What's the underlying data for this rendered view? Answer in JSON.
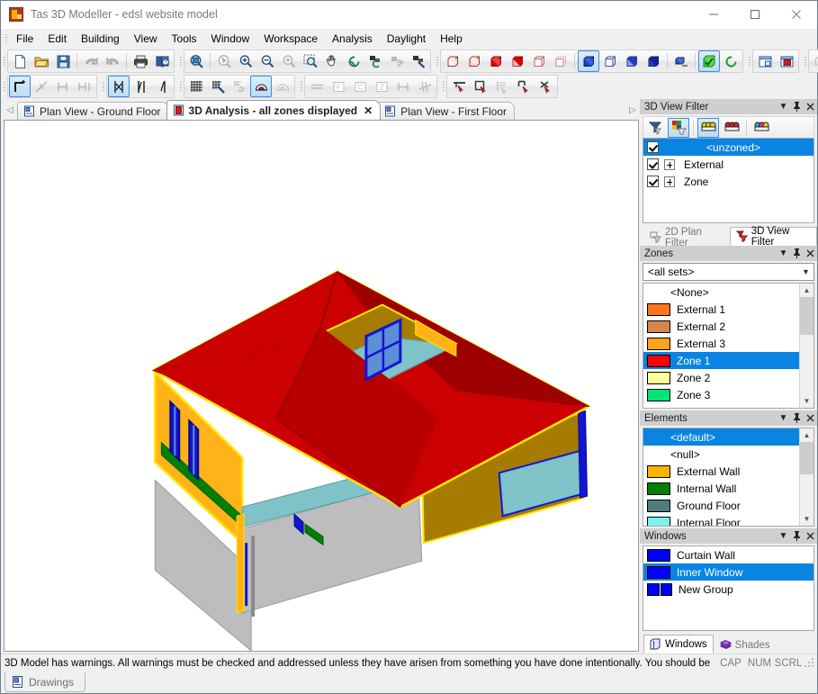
{
  "window": {
    "title": "Tas 3D Modeller - edsl website model",
    "app_icon": "tas-app-icon",
    "controls": {
      "minimize": "minimize-icon",
      "maximize": "maximize-icon",
      "close": "close-icon"
    }
  },
  "menubar": {
    "items": [
      {
        "label": "File"
      },
      {
        "label": "Edit"
      },
      {
        "label": "Building"
      },
      {
        "label": "View"
      },
      {
        "label": "Tools"
      },
      {
        "label": "Window"
      },
      {
        "label": "Workspace"
      },
      {
        "label": "Analysis"
      },
      {
        "label": "Daylight"
      },
      {
        "label": "Help"
      }
    ]
  },
  "toolbars": {
    "row1": [
      {
        "group": "file",
        "buttons": [
          {
            "name": "new-file-icon",
            "selected": false,
            "enabled": true
          },
          {
            "name": "open-folder-icon",
            "selected": false,
            "enabled": true
          },
          {
            "name": "save-disk-icon",
            "selected": false,
            "enabled": true
          },
          {
            "sep": true
          },
          {
            "name": "undo-icon",
            "selected": false,
            "enabled": false
          },
          {
            "name": "redo-icon",
            "selected": false,
            "enabled": false
          },
          {
            "sep": true
          },
          {
            "name": "print-icon",
            "selected": false,
            "enabled": true
          },
          {
            "name": "help-book-icon",
            "selected": false,
            "enabled": true
          }
        ]
      },
      {
        "group": "zoom",
        "buttons": [
          {
            "name": "zoom-extents-icon",
            "selected": false,
            "enabled": true
          },
          {
            "sep": true
          },
          {
            "name": "zoom-select-icon",
            "selected": false,
            "enabled": false
          },
          {
            "name": "zoom-in-icon",
            "selected": false,
            "enabled": true
          },
          {
            "name": "zoom-out-icon",
            "selected": false,
            "enabled": true
          },
          {
            "name": "zoom-reset-icon",
            "selected": false,
            "enabled": false
          },
          {
            "name": "zoom-window-icon",
            "selected": false,
            "enabled": true
          },
          {
            "name": "pan-hand-icon",
            "selected": false,
            "enabled": true
          },
          {
            "name": "orbit-rotate-icon",
            "selected": false,
            "enabled": true
          },
          {
            "name": "rotate-view-icon",
            "selected": false,
            "enabled": true
          },
          {
            "name": "view-arrow-icon",
            "selected": false,
            "enabled": false
          },
          {
            "name": "view-pick-icon",
            "selected": false,
            "enabled": true
          }
        ]
      },
      {
        "group": "zone-display",
        "buttons": [
          {
            "name": "zone-outline-icon",
            "selected": false,
            "enabled": true
          },
          {
            "name": "zone-shaded-icon",
            "selected": false,
            "enabled": true
          },
          {
            "name": "zone-solid-red-icon",
            "selected": false,
            "enabled": true
          },
          {
            "name": "zone-solid-shaded-icon",
            "selected": false,
            "enabled": true
          },
          {
            "name": "zone-wire-icon",
            "selected": false,
            "enabled": true
          },
          {
            "name": "zone-hidden-icon",
            "selected": false,
            "enabled": true
          },
          {
            "sep": true
          },
          {
            "name": "view-solid-blue-icon",
            "selected": true,
            "enabled": true
          },
          {
            "name": "view-wireframe-icon",
            "selected": false,
            "enabled": true
          },
          {
            "name": "view-shaded-blue-icon",
            "selected": false,
            "enabled": true
          },
          {
            "name": "view-render-blue-icon",
            "selected": false,
            "enabled": true
          },
          {
            "sep": true
          },
          {
            "name": "ground-plane-icon",
            "selected": false,
            "enabled": true
          },
          {
            "sep": true
          },
          {
            "name": "check-model-icon",
            "selected": true,
            "enabled": true
          },
          {
            "name": "refresh-icon",
            "selected": false,
            "enabled": true
          }
        ]
      },
      {
        "group": "window-tools",
        "buttons": [
          {
            "name": "new-window-icon",
            "selected": false,
            "enabled": true
          },
          {
            "name": "active-window-icon",
            "selected": false,
            "enabled": true
          }
        ]
      },
      {
        "group": "export",
        "buttons": [
          {
            "name": "export-model-icon",
            "selected": false,
            "enabled": false
          }
        ]
      }
    ],
    "row2": [
      {
        "group": "draw",
        "buttons": [
          {
            "name": "draw-wall-icon",
            "selected": true,
            "enabled": true
          },
          {
            "name": "draw-break-icon",
            "selected": false,
            "enabled": false
          },
          {
            "name": "draw-extend-icon",
            "selected": false,
            "enabled": false
          },
          {
            "name": "draw-trim-icon",
            "selected": false,
            "enabled": false
          }
        ]
      },
      {
        "group": "snap",
        "buttons": [
          {
            "name": "snap-midpoint-icon",
            "selected": true,
            "enabled": true
          },
          {
            "name": "snap-endpoint-icon",
            "selected": false,
            "enabled": true
          },
          {
            "name": "snap-vertex-icon",
            "selected": false,
            "enabled": true
          }
        ]
      },
      {
        "group": "grid",
        "buttons": [
          {
            "name": "grid-icon",
            "selected": false,
            "enabled": true
          },
          {
            "name": "grid-snap-icon",
            "selected": false,
            "enabled": true
          },
          {
            "name": "measure-icon",
            "selected": false,
            "enabled": false
          },
          {
            "name": "shade-tool-icon",
            "selected": true,
            "enabled": true
          },
          {
            "name": "shade-copy-icon",
            "selected": false,
            "enabled": false
          }
        ]
      },
      {
        "group": "dimension",
        "buttons": [
          {
            "name": "dimension-line-icon",
            "selected": false,
            "enabled": false
          },
          {
            "name": "feature-label-icon",
            "selected": false,
            "enabled": false
          },
          {
            "name": "condition-label-icon",
            "selected": false,
            "enabled": false
          },
          {
            "name": "zone-label-icon",
            "selected": false,
            "enabled": false
          },
          {
            "name": "span-icon",
            "selected": false,
            "enabled": false
          },
          {
            "name": "parallel-icon",
            "selected": false,
            "enabled": false
          }
        ]
      },
      {
        "group": "select",
        "buttons": [
          {
            "name": "select-top-icon",
            "selected": false,
            "enabled": true
          },
          {
            "name": "select-box-icon",
            "selected": false,
            "enabled": true
          },
          {
            "name": "select-list-icon",
            "selected": false,
            "enabled": false
          },
          {
            "name": "select-edge-icon",
            "selected": false,
            "enabled": true
          },
          {
            "name": "select-cross-icon",
            "selected": false,
            "enabled": true
          }
        ]
      }
    ]
  },
  "tabs": {
    "nav_left": "scroll-tabs-left-icon",
    "nav_right": "scroll-tabs-right-icon",
    "items": [
      {
        "label": "Plan View - Ground Floor",
        "icon": "plan-view-icon",
        "active": false,
        "closable": false
      },
      {
        "label": "3D Analysis - all zones displayed",
        "icon": "three-d-view-icon",
        "active": true,
        "closable": true,
        "close_label": "✕"
      },
      {
        "label": "Plan View - First Floor",
        "icon": "plan-view-icon",
        "active": false,
        "closable": false
      }
    ]
  },
  "viewport": {
    "name": "3d-model-viewport",
    "background": "#ffffff",
    "colors": {
      "roof_light": "#cc0000",
      "roof_dark": "#9e0000",
      "roof_mid": "#b80000",
      "wall_orange": "#ffb319",
      "wall_dark_gold": "#a67c00",
      "floor_teal": "#7fc2c8",
      "shade_grey": "#bdbdbd",
      "edge_yellow": "#ffe400",
      "window_blue": "#1414d2",
      "window_glass": "#5b8fd6",
      "internal_wall_green": "#007f00"
    }
  },
  "dock": {
    "view_filter": {
      "title": "3D View Filter",
      "header_buttons": {
        "menu": "chevron-down-icon",
        "pin": "pin-icon",
        "close": "close-icon"
      },
      "toolbar": [
        {
          "name": "filter-all-icon",
          "selected": false
        },
        {
          "name": "filter-colour-icon",
          "selected": true
        },
        {
          "name": "zone-group-yellow-icon",
          "selected": true
        },
        {
          "name": "zone-group-red-icon",
          "selected": false
        },
        {
          "name": "zone-group-magenta-icon",
          "selected": false
        }
      ],
      "rows": [
        {
          "label": "<unzoned>",
          "checked": true,
          "expandable": false,
          "selected": true
        },
        {
          "label": "External",
          "checked": true,
          "expandable": true,
          "selected": false
        },
        {
          "label": "Zone",
          "checked": true,
          "expandable": true,
          "selected": false
        }
      ],
      "tabs": [
        {
          "label": "2D Plan Filter",
          "icon": "plan-filter-icon",
          "active": false
        },
        {
          "label": "3D View Filter",
          "icon": "view-filter-icon",
          "active": true
        }
      ]
    },
    "zones": {
      "title": "Zones",
      "header_buttons": {
        "menu": "chevron-down-icon",
        "pin": "pin-icon",
        "close": "close-icon"
      },
      "set_selector": {
        "value": "<all sets>",
        "arrow": "chevron-down-icon"
      },
      "items": [
        {
          "label": "<None>",
          "colour": null,
          "selected": false
        },
        {
          "label": "External 1",
          "colour": "#ff7518",
          "selected": false
        },
        {
          "label": "External 2",
          "colour": "#d4884f",
          "selected": false
        },
        {
          "label": "External 3",
          "colour": "#ffa31a",
          "selected": false
        },
        {
          "label": "Zone 1",
          "colour": "#ff0000",
          "selected": true
        },
        {
          "label": "Zone 2",
          "colour": "#ffff99",
          "selected": false
        },
        {
          "label": "Zone 3",
          "colour": "#00e676",
          "selected": false
        }
      ],
      "scrollbar": {
        "up": "scroll-up-icon",
        "down": "scroll-down-icon"
      }
    },
    "elements": {
      "title": "Elements",
      "header_buttons": {
        "menu": "chevron-down-icon",
        "pin": "pin-icon",
        "close": "close-icon"
      },
      "items": [
        {
          "label": "<default>",
          "colour": null,
          "selected": true
        },
        {
          "label": "<null>",
          "colour": null,
          "selected": false
        },
        {
          "label": "External Wall",
          "colour": "#ffb300",
          "selected": false
        },
        {
          "label": "Internal Wall",
          "colour": "#007f00",
          "selected": false
        },
        {
          "label": "Ground Floor",
          "colour": "#4f7c7c",
          "selected": false
        },
        {
          "label": "Internal Floor",
          "colour": "#7ff0f0",
          "selected": false
        }
      ],
      "scrollbar": {
        "up": "scroll-up-icon",
        "down": "scroll-down-icon"
      }
    },
    "windows": {
      "title": "Windows",
      "header_buttons": {
        "menu": "chevron-down-icon",
        "pin": "pin-icon",
        "close": "close-icon"
      },
      "items": [
        {
          "label": "Curtain Wall",
          "colour": "#0000ff",
          "dual": false,
          "selected": false
        },
        {
          "label": "Inner Window",
          "colour": "#0000ff",
          "dual": false,
          "selected": true
        },
        {
          "label": "New Group",
          "colour": "#0000ff",
          "dual": true,
          "selected": false
        }
      ],
      "tabs": [
        {
          "label": "Windows",
          "icon": "windows-icon",
          "active": true
        },
        {
          "label": "Shades",
          "icon": "shades-icon",
          "active": false
        }
      ]
    }
  },
  "statusbar": {
    "message": "3D Model has warnings. All warnings must be checked and addressed unless they have arisen from something you have done intentionally. You should be",
    "indicators": [
      "CAP",
      "NUM",
      "SCRL"
    ],
    "resize_grip": "resize-grip-icon"
  },
  "bottom_dock": {
    "tabs": [
      {
        "label": "Drawings",
        "icon": "drawings-icon",
        "active": false
      }
    ]
  }
}
